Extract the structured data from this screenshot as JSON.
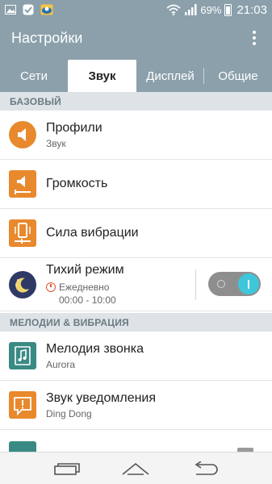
{
  "status_bar": {
    "battery_percent": "69%",
    "time": "21:03"
  },
  "app_bar": {
    "title": "Настройки"
  },
  "tabs": [
    {
      "label": "Сети",
      "selected": false
    },
    {
      "label": "Звук",
      "selected": true
    },
    {
      "label": "Дисплей",
      "selected": false
    },
    {
      "label": "Общие",
      "selected": false
    }
  ],
  "sections": {
    "basic": "БАЗОВЫЙ",
    "ringtones": "МЕЛОДИИ & ВИБРАЦИЯ"
  },
  "rows": {
    "profiles": {
      "title": "Профили",
      "subtitle": "Звук"
    },
    "volume": {
      "title": "Громкость"
    },
    "vibration": {
      "title": "Сила вибрации"
    },
    "quiet_mode": {
      "title": "Тихий режим",
      "schedule": "Ежедневно",
      "time_range": "00:00 - 10:00",
      "enabled": true
    },
    "ringtone": {
      "title": "Мелодия звонка",
      "subtitle": "Aurora"
    },
    "notification": {
      "title": "Звук уведомления",
      "subtitle": "Ding Dong"
    }
  },
  "colors": {
    "header": "#8ba0ab",
    "accent_orange": "#e8892d",
    "toggle_on": "#3ec7db",
    "section_bg": "#dde3e7"
  }
}
